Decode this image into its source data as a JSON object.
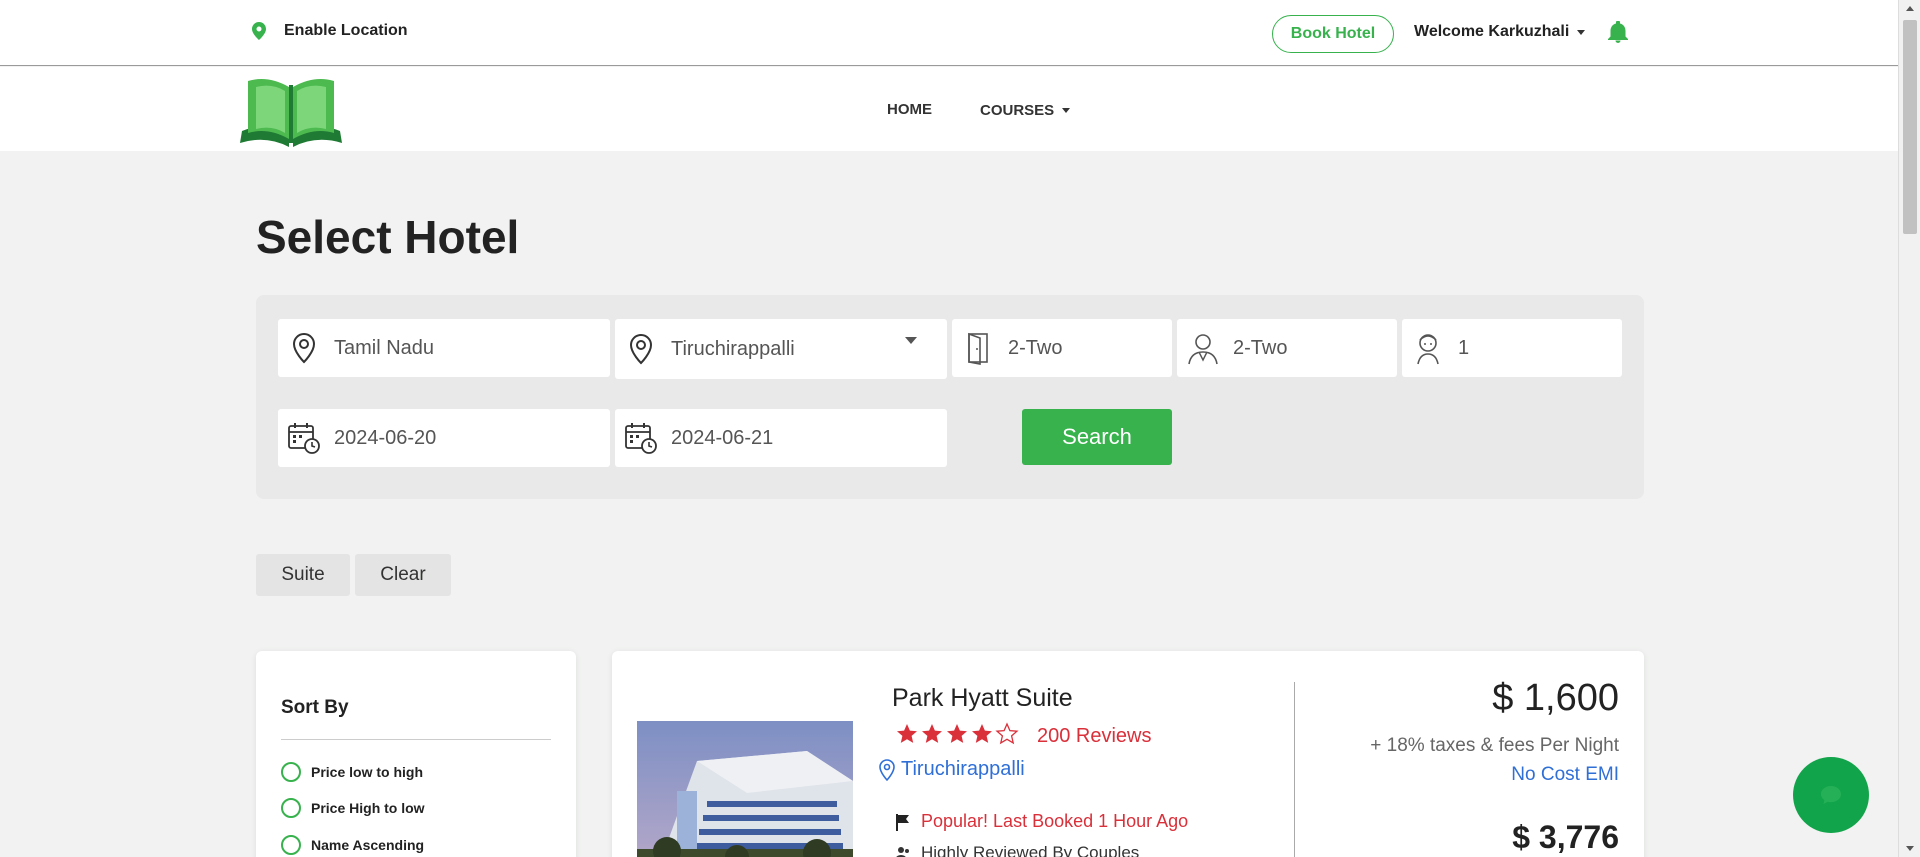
{
  "topbar": {
    "enable_location": "Enable Location",
    "book_hotel": "Book Hotel",
    "welcome": "Welcome Karkuzhali"
  },
  "nav": {
    "home": "HOME",
    "courses": "COURSES"
  },
  "page": {
    "title": "Select Hotel"
  },
  "search": {
    "state": "Tamil Nadu",
    "city": "Tiruchirappalli",
    "rooms": "2-Two",
    "adults": "2-Two",
    "children": "1",
    "checkin": "2024-06-20",
    "checkout": "2024-06-21",
    "button": "Search"
  },
  "chips": [
    "Suite",
    "Clear"
  ],
  "sort": {
    "title": "Sort By",
    "options": [
      "Price low to high",
      "Price High to low",
      "Name Ascending"
    ]
  },
  "hotel": {
    "name": "Park Hyatt Suite",
    "rating": 4,
    "max_rating": 5,
    "reviews": "200 Reviews",
    "city": "Tiruchirappalli",
    "popular": "Popular! Last Booked 1 Hour Ago",
    "reviewed": "Highly Reviewed By Couples",
    "price": "$ 1,600",
    "taxes": "+ 18% taxes & fees Per Night",
    "emi": "No Cost EMI",
    "price2": "$ 3,776"
  },
  "colors": {
    "accent": "#37b24d",
    "danger": "#d9303a",
    "link": "#2f6fd6"
  }
}
